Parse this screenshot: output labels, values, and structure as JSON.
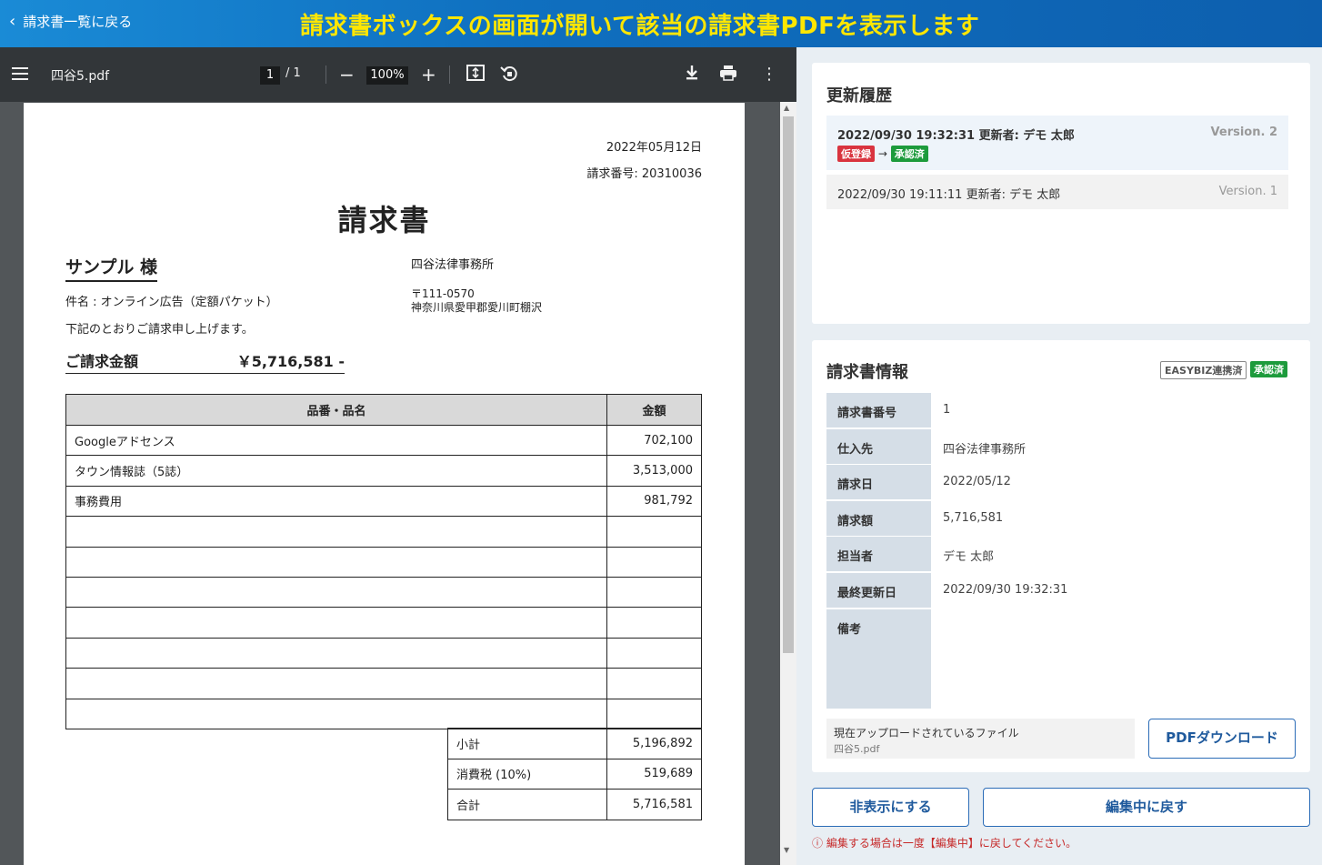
{
  "header": {
    "back_label": "請求書一覧に戻る",
    "banner": "請求書ボックスの画面が開いて該当の請求書PDFを表示します"
  },
  "viewer": {
    "filename": "四谷5.pdf",
    "page_current": "1",
    "page_total": "/ 1",
    "zoom": "100%"
  },
  "pdf": {
    "date": "2022年05月12日",
    "invoice_no": "請求番号: 20310036",
    "title": "請求書",
    "client": "サンプル 様",
    "subject": "件名 : オンライン広告（定額パケット）",
    "note": "下記のとおりご請求申し上げます。",
    "company": "四谷法律事務所",
    "zip": "〒111-0570",
    "address": "神奈川県愛甲郡愛川町棚沢",
    "amount_label": "ご請求金額",
    "amount_value": "￥5,716,581 -",
    "col_item": "品番・品名",
    "col_amount": "金額",
    "rows": [
      {
        "name": "Googleアドセンス",
        "amount": "702,100"
      },
      {
        "name": "タウン情報誌（5誌）",
        "amount": "3,513,000"
      },
      {
        "name": "事務費用",
        "amount": "981,792"
      },
      {
        "name": "",
        "amount": ""
      },
      {
        "name": "",
        "amount": ""
      },
      {
        "name": "",
        "amount": ""
      },
      {
        "name": "",
        "amount": ""
      },
      {
        "name": "",
        "amount": ""
      },
      {
        "name": "",
        "amount": ""
      },
      {
        "name": "",
        "amount": ""
      }
    ],
    "totals": [
      {
        "label": "小計",
        "value": "5,196,892"
      },
      {
        "label": "消費税 (10%)",
        "value": "519,689"
      },
      {
        "label": "合計",
        "value": "5,716,581"
      }
    ]
  },
  "history": {
    "title": "更新履歴",
    "entries": [
      {
        "text": "2022/09/30  19:32:31  更新者: デモ 太郎",
        "version": "Version. 2",
        "from": "仮登録",
        "arrow": "→",
        "to": "承認済"
      },
      {
        "text": "2022/09/30  19:11:11  更新者: デモ 太郎",
        "version": "Version. 1"
      }
    ]
  },
  "info": {
    "title": "請求書情報",
    "badge_easybiz": "EASYBIZ連携済",
    "badge_status": "承認済",
    "rows": [
      {
        "label": "請求書番号",
        "value": "1"
      },
      {
        "label": "仕入先",
        "value": "四谷法律事務所"
      },
      {
        "label": "請求日",
        "value": "2022/05/12"
      },
      {
        "label": "請求額",
        "value": "5,716,581"
      },
      {
        "label": "担当者",
        "value": "デモ 太郎"
      },
      {
        "label": "最終更新日",
        "value": "2022/09/30 19:32:31"
      },
      {
        "label": "備考",
        "value": ""
      }
    ],
    "file_label": "現在アップロードされているファイル",
    "file_name": "四谷5.pdf",
    "download_label": "PDFダウンロード"
  },
  "actions": {
    "hide_label": "非表示にする",
    "revert_label": "編集中に戻す",
    "warning": "ⓘ 編集する場合は一度【編集中】に戻してください。"
  }
}
